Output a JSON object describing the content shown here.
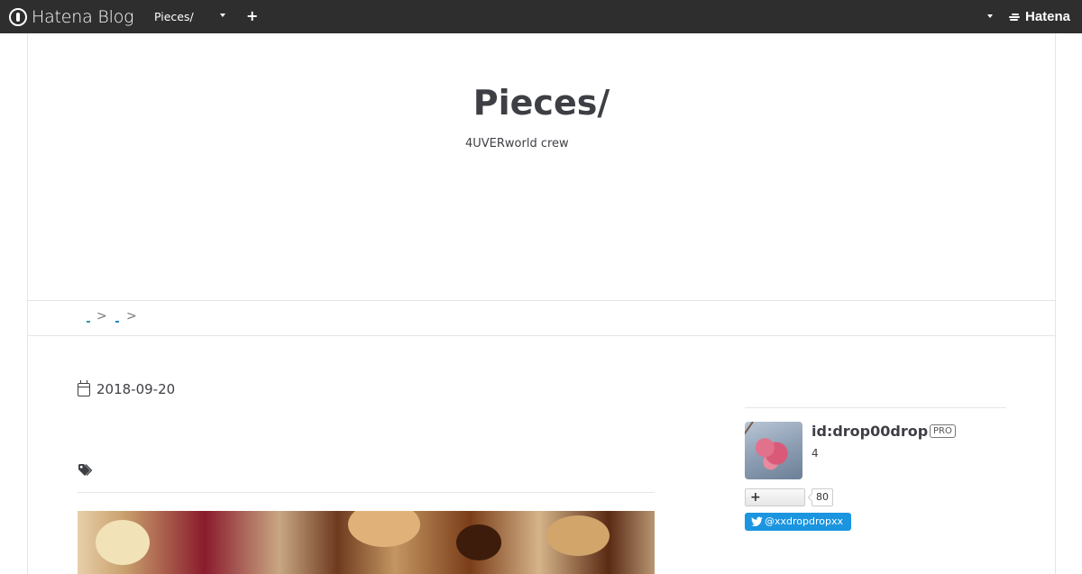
{
  "global_header": {
    "logo_text": "Hatena Blog",
    "blog_name": "Pieces/",
    "hatena_text": "Hatena"
  },
  "blog": {
    "title": "Pieces/",
    "description": "4UVERworld crew"
  },
  "breadcrumb": {
    "separator": ">"
  },
  "entry": {
    "date": "2018-09-20"
  },
  "sidebar": {
    "profile_id": "id:drop00drop",
    "pro_label": "PRO",
    "count": "4",
    "subscribe_count": "80",
    "twitter_label": "@xxdropdropxx"
  },
  "colors": {
    "header_bg": "#2e2e2e",
    "twitter_blue": "#1b95e0",
    "link_blue": "#1e88c8"
  }
}
